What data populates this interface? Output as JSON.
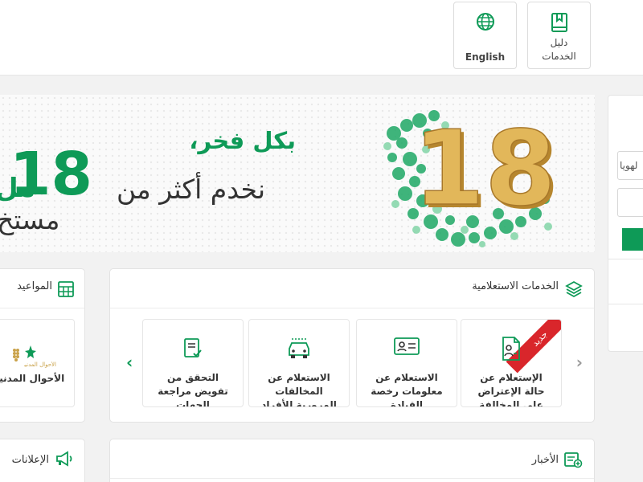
{
  "header": {
    "guide_label_1": "دليل",
    "guide_label_2": "الخدمات",
    "language_label": "English"
  },
  "banner": {
    "line1": "بكل فخر،",
    "line2": "نخدم أكثر من",
    "number": "18",
    "million": "مل",
    "line3": "مستخ",
    "badge_number": "18"
  },
  "sidebar": {
    "input_placeholder": "لهويا"
  },
  "services": {
    "title": "الخدمات الاستعلامية",
    "new_badge": "جديد",
    "cards": [
      {
        "line1": "الإستعلام عن",
        "line2": "حالة الإعتراض",
        "line3": "على المخالفة"
      },
      {
        "line1": "الاستعلام عن",
        "line2": "معلومات رخصة",
        "line3": "القيادة"
      },
      {
        "line1": "الاستعلام عن",
        "line2": "المخالفات",
        "line3": "المرورية للأفراد"
      },
      {
        "line1": "التحقق من",
        "line2": "تفويض مراجعة",
        "line3": "الجهات"
      }
    ]
  },
  "appointments": {
    "title": "المواعيد",
    "card_label": "الأحوال المدنية",
    "logo_text": "الأحوال المدنية"
  },
  "news": {
    "title": "الأخبار"
  },
  "ads": {
    "title": "الإعلانات"
  },
  "colors": {
    "brand_green": "#0e9a57",
    "badge_red": "#d9262b",
    "gold": "#d4a84a"
  }
}
